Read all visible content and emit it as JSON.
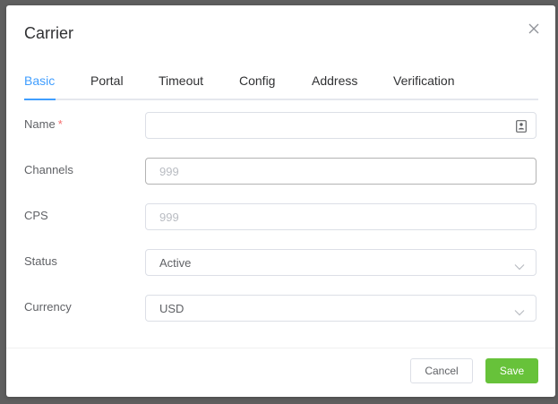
{
  "dialog": {
    "title": "Carrier",
    "close_icon": "close-icon"
  },
  "tabs": [
    {
      "label": "Basic",
      "active": true
    },
    {
      "label": "Portal",
      "active": false
    },
    {
      "label": "Timeout",
      "active": false
    },
    {
      "label": "Config",
      "active": false
    },
    {
      "label": "Address",
      "active": false
    },
    {
      "label": "Verification",
      "active": false
    }
  ],
  "form": {
    "name": {
      "label": "Name",
      "required_mark": "*",
      "value": "",
      "placeholder": "",
      "icon": "contact-card-icon"
    },
    "channels": {
      "label": "Channels",
      "value": "",
      "placeholder": "999"
    },
    "cps": {
      "label": "CPS",
      "value": "",
      "placeholder": "999"
    },
    "status": {
      "label": "Status",
      "selected": "Active"
    },
    "currency": {
      "label": "Currency",
      "selected": "USD"
    }
  },
  "footer": {
    "cancel_label": "Cancel",
    "save_label": "Save"
  },
  "colors": {
    "accent": "#409eff",
    "save_button": "#67c23a",
    "required": "#f56c6c"
  }
}
